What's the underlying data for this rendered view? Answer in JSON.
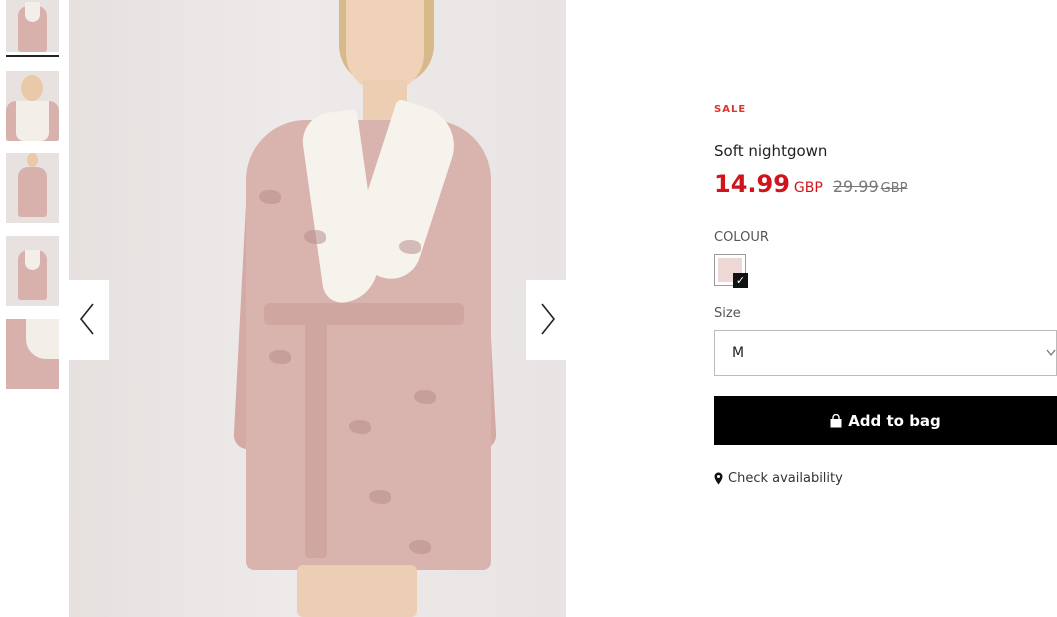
{
  "gallery": {
    "thumbnails": [
      {
        "name": "thumbnail-1",
        "active": true
      },
      {
        "name": "thumbnail-2",
        "active": false
      },
      {
        "name": "thumbnail-3",
        "active": false
      },
      {
        "name": "thumbnail-4",
        "active": false
      },
      {
        "name": "thumbnail-5",
        "active": false
      }
    ],
    "prev_icon": "chevron-left-icon",
    "next_icon": "chevron-right-icon"
  },
  "product": {
    "sale_label": "SALE",
    "title": "Soft nightgown",
    "price": "14.99",
    "price_currency": "GBP",
    "old_price": "29.99",
    "old_price_currency": "GBP",
    "colors": {
      "sale": "#e0352f",
      "price": "#d0141d",
      "button": "#000000"
    }
  },
  "colour": {
    "label": "COLOUR",
    "swatch_color": "#eed8d6",
    "selected": true
  },
  "size": {
    "label": "Size",
    "selected": "M"
  },
  "actions": {
    "add_to_bag": "Add to bag",
    "add_to_bag_icon": "shopping-bag-icon",
    "check_availability": "Check availability",
    "check_availability_icon": "location-pin-icon"
  }
}
